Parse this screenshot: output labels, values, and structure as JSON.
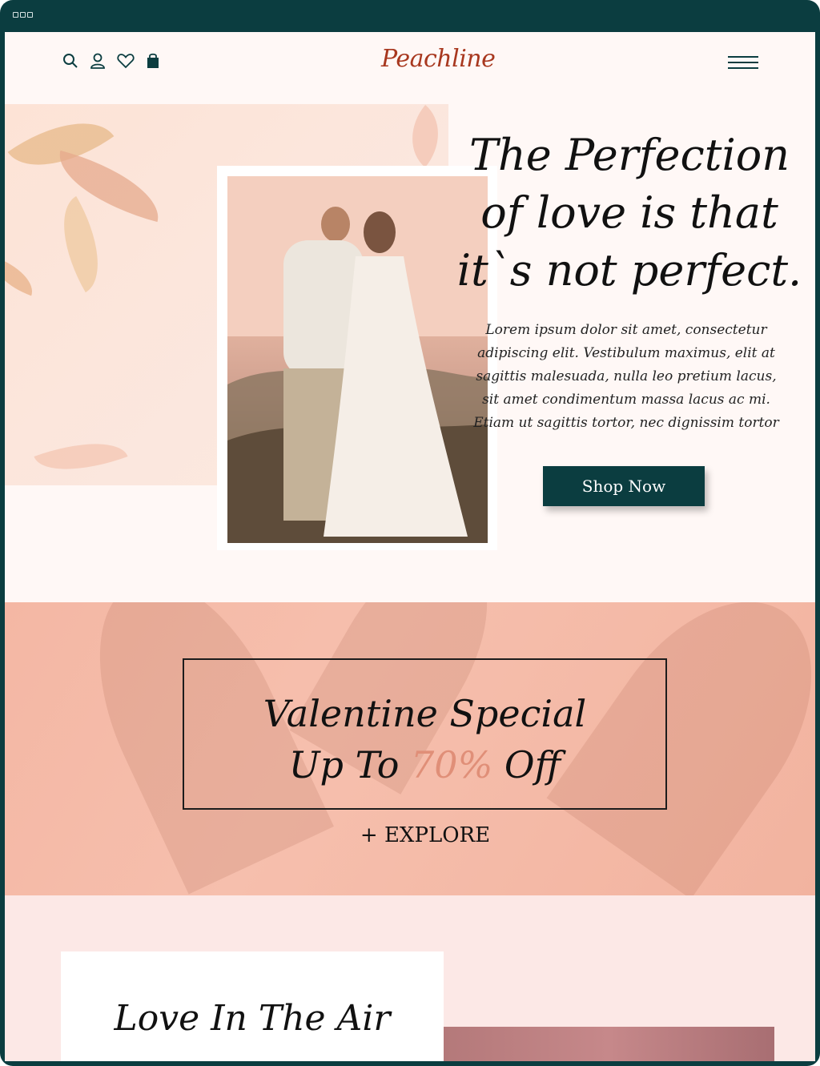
{
  "brand": {
    "logo": "Peachline",
    "color": "#a8381f"
  },
  "header": {
    "icons": [
      "search-icon",
      "user-icon",
      "heart-icon",
      "bag-icon"
    ],
    "menu_icon": "hamburger-menu-icon"
  },
  "hero": {
    "title": "The Perfection of love is that it`s not perfect.",
    "text": "Lorem ipsum dolor sit amet, consectetur adipiscing elit. Vestibulum maximus, elit at sagittis malesuada, nulla leo pretium lacus, sit amet condimentum massa lacus ac mi. Etiam ut sagittis tortor, nec dignissim tortor",
    "cta_label": "Shop Now"
  },
  "promo": {
    "line1": "Valentine Special",
    "line2_prefix": "Up To ",
    "line2_highlight": "70%",
    "line2_suffix": " Off",
    "explore_label": "+ EXPLORE"
  },
  "section2": {
    "title": "Love In The Air"
  },
  "colors": {
    "dark_teal": "#0b3d40",
    "peach": "#f4b7a4",
    "highlight": "#e08f78"
  }
}
